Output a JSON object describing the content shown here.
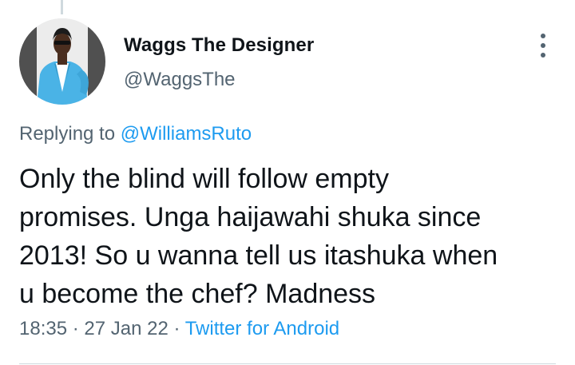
{
  "tweet": {
    "author_name": "Waggs The Designer",
    "author_handle": "@WaggsThe",
    "replying_prefix": "Replying to ",
    "replying_to": "@WilliamsRuto",
    "text": "Only the blind will follow empty\npromises.  Unga haijawahi shuka since\n2013! So u wanna tell us itashuka when\nu become the chef? Madness",
    "time": "18:35",
    "separator": " · ",
    "date": "27 Jan 22",
    "source": "Twitter for Android"
  },
  "icons": {
    "more": "more-vertical-icon",
    "avatar": "profile-photo"
  },
  "colors": {
    "text_primary": "#0f1419",
    "text_secondary": "#536471",
    "link": "#1d9bf0",
    "divider": "#cfd9de",
    "avatar_jacket": "#4ab3e6"
  }
}
